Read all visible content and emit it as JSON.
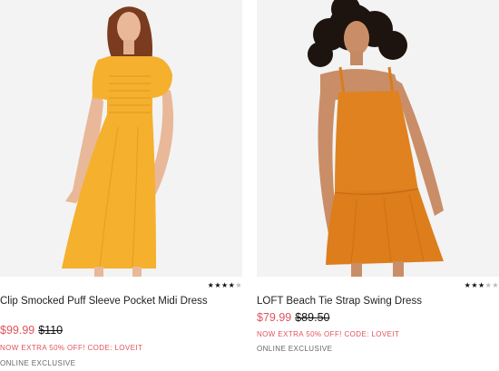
{
  "products": [
    {
      "name": "Clip Smocked Puff Sleeve Pocket Midi Dress",
      "sale_price": "$99.99",
      "original_price": "$110",
      "promo": "NOW EXTRA 50% OFF! CODE: LOVEIT",
      "exclusive": "ONLINE EXCLUSIVE",
      "rating": 4,
      "rating_max": 5,
      "dress_color": "#f5b02e"
    },
    {
      "name": "LOFT Beach Tie Strap Swing Dress",
      "sale_price": "$79.99",
      "original_price": "$89.50",
      "promo": "NOW EXTRA 50% OFF! CODE: LOVEIT",
      "exclusive": "ONLINE EXCLUSIVE",
      "rating": 3,
      "rating_max": 5,
      "dress_color": "#e0821f"
    }
  ],
  "colors": {
    "sale": "#e0535d",
    "photo_bg": "#f2f2f2"
  }
}
